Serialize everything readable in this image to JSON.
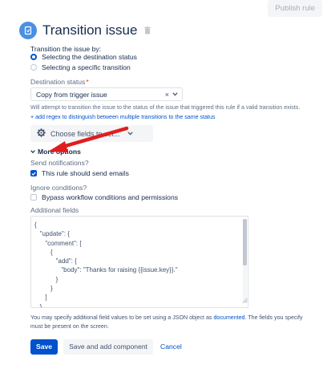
{
  "toolbar": {
    "publish_label": "Publish rule"
  },
  "header": {
    "title": "Transition issue",
    "icon": "transition-issue-icon",
    "accent": "#4a90e2"
  },
  "transition_by": {
    "label": "Transition the issue by:",
    "options": [
      "Selecting the destination status",
      "Selecting a specific transition"
    ],
    "selected": "Selecting the destination status"
  },
  "destination": {
    "label": "Destination status",
    "required_mark": "*",
    "value": "Copy from trigger issue",
    "help": "Will attempt to transition the issue to the status of the issue that triggered this rule if a valid transition exists.",
    "regex_link": "+ add regex to distinguish between multiple transitions to the same status"
  },
  "fields_button": {
    "label": "Choose fields to set..."
  },
  "more_options": {
    "label": "More options"
  },
  "notifications": {
    "label": "Send notifications?",
    "checkbox_label": "This rule should send emails",
    "checked": true
  },
  "ignore": {
    "label": "Ignore conditions?",
    "checkbox_label": "Bypass workflow conditions and permissions",
    "checked": false
  },
  "additional_fields": {
    "label": "Additional fields",
    "value": "{\n   \"update\": {\n      \"comment\": [\n         {\n            \"add\": {\n               \"body\": \"Thanks for raising {{issue.key}}.\"\n            }\n         }\n      ]\n   },"
  },
  "note": {
    "before": "You may specify additional field values to be set using a JSON object as ",
    "link": "documented",
    "after": ". The fields you specify must be present on the screen."
  },
  "actions": {
    "save": "Save",
    "save_add": "Save and add component",
    "cancel": "Cancel"
  },
  "colors": {
    "primary": "#0052cc",
    "annotation": "#e01e1e"
  }
}
